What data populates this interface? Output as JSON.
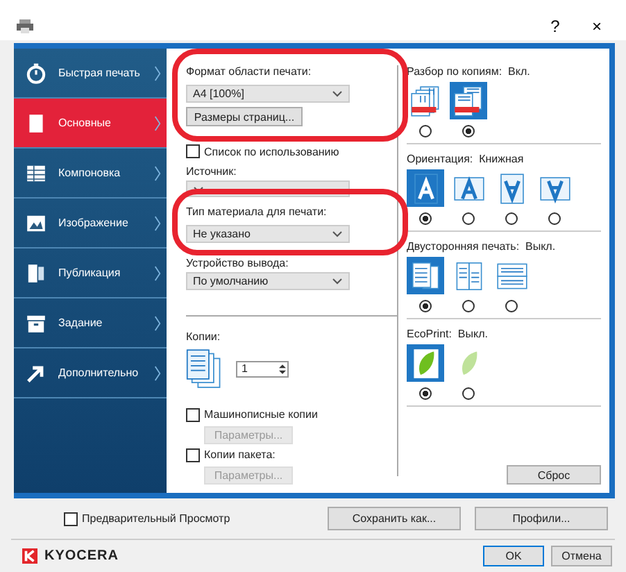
{
  "window": {
    "help": "?",
    "close": "×"
  },
  "sidebar": {
    "items": [
      {
        "label": "Быстрая печать",
        "selected": false
      },
      {
        "label": "Основные",
        "selected": true
      },
      {
        "label": "Компоновка",
        "selected": false
      },
      {
        "label": "Изображение",
        "selected": false
      },
      {
        "label": "Публикация",
        "selected": false
      },
      {
        "label": "Задание",
        "selected": false
      },
      {
        "label": "Дополнительно",
        "selected": false
      }
    ]
  },
  "print_area": {
    "label": "Формат области печати:",
    "value": "A4  [100%]",
    "button": "Размеры страниц...",
    "highlighted": true
  },
  "source_list": {
    "label": "Список по использованию",
    "checked": false
  },
  "source": {
    "label": "Источник:"
  },
  "media_type": {
    "label": "Тип материала для печати:",
    "value": "Не указано",
    "highlighted": true
  },
  "output": {
    "label": "Устройство вывода:",
    "value": "По умолчанию"
  },
  "copies": {
    "label": "Копии:",
    "value": "1"
  },
  "mopy": {
    "label": "Машинописные копии",
    "checked": false,
    "button": "Параметры...",
    "disabled": true
  },
  "batch": {
    "label": "Копии пакета:",
    "checked": false,
    "button": "Параметры...",
    "disabled": true
  },
  "collate": {
    "label": "Разбор по копиям:",
    "state": "Вкл.",
    "options": [
      {
        "kind": "uncollated",
        "selected": false
      },
      {
        "kind": "collated",
        "selected": true
      }
    ]
  },
  "orientation": {
    "label": "Ориентация:",
    "state": "Книжная",
    "options": [
      {
        "kind": "portrait",
        "selected": true
      },
      {
        "kind": "landscape",
        "selected": false
      },
      {
        "kind": "portrait-rotated",
        "selected": false
      },
      {
        "kind": "landscape-rotated",
        "selected": false
      }
    ]
  },
  "duplex": {
    "label": "Двусторонняя печать:",
    "state": "Выкл.",
    "options": [
      {
        "kind": "simplex",
        "selected": true
      },
      {
        "kind": "long-edge",
        "selected": false
      },
      {
        "kind": "short-edge",
        "selected": false
      }
    ]
  },
  "ecoprint": {
    "label": "EcoPrint:",
    "state": "Выкл.",
    "options": [
      {
        "kind": "eco-off",
        "selected": true
      },
      {
        "kind": "eco-on",
        "selected": false
      }
    ]
  },
  "reset_button": "Сброс",
  "preview": {
    "label": "Предварительный Просмотр",
    "checked": false
  },
  "buttons": {
    "save_as": "Сохранить как...",
    "profiles": "Профили...",
    "ok": "OK",
    "cancel": "Отмена"
  },
  "brand": "KYOCERA"
}
